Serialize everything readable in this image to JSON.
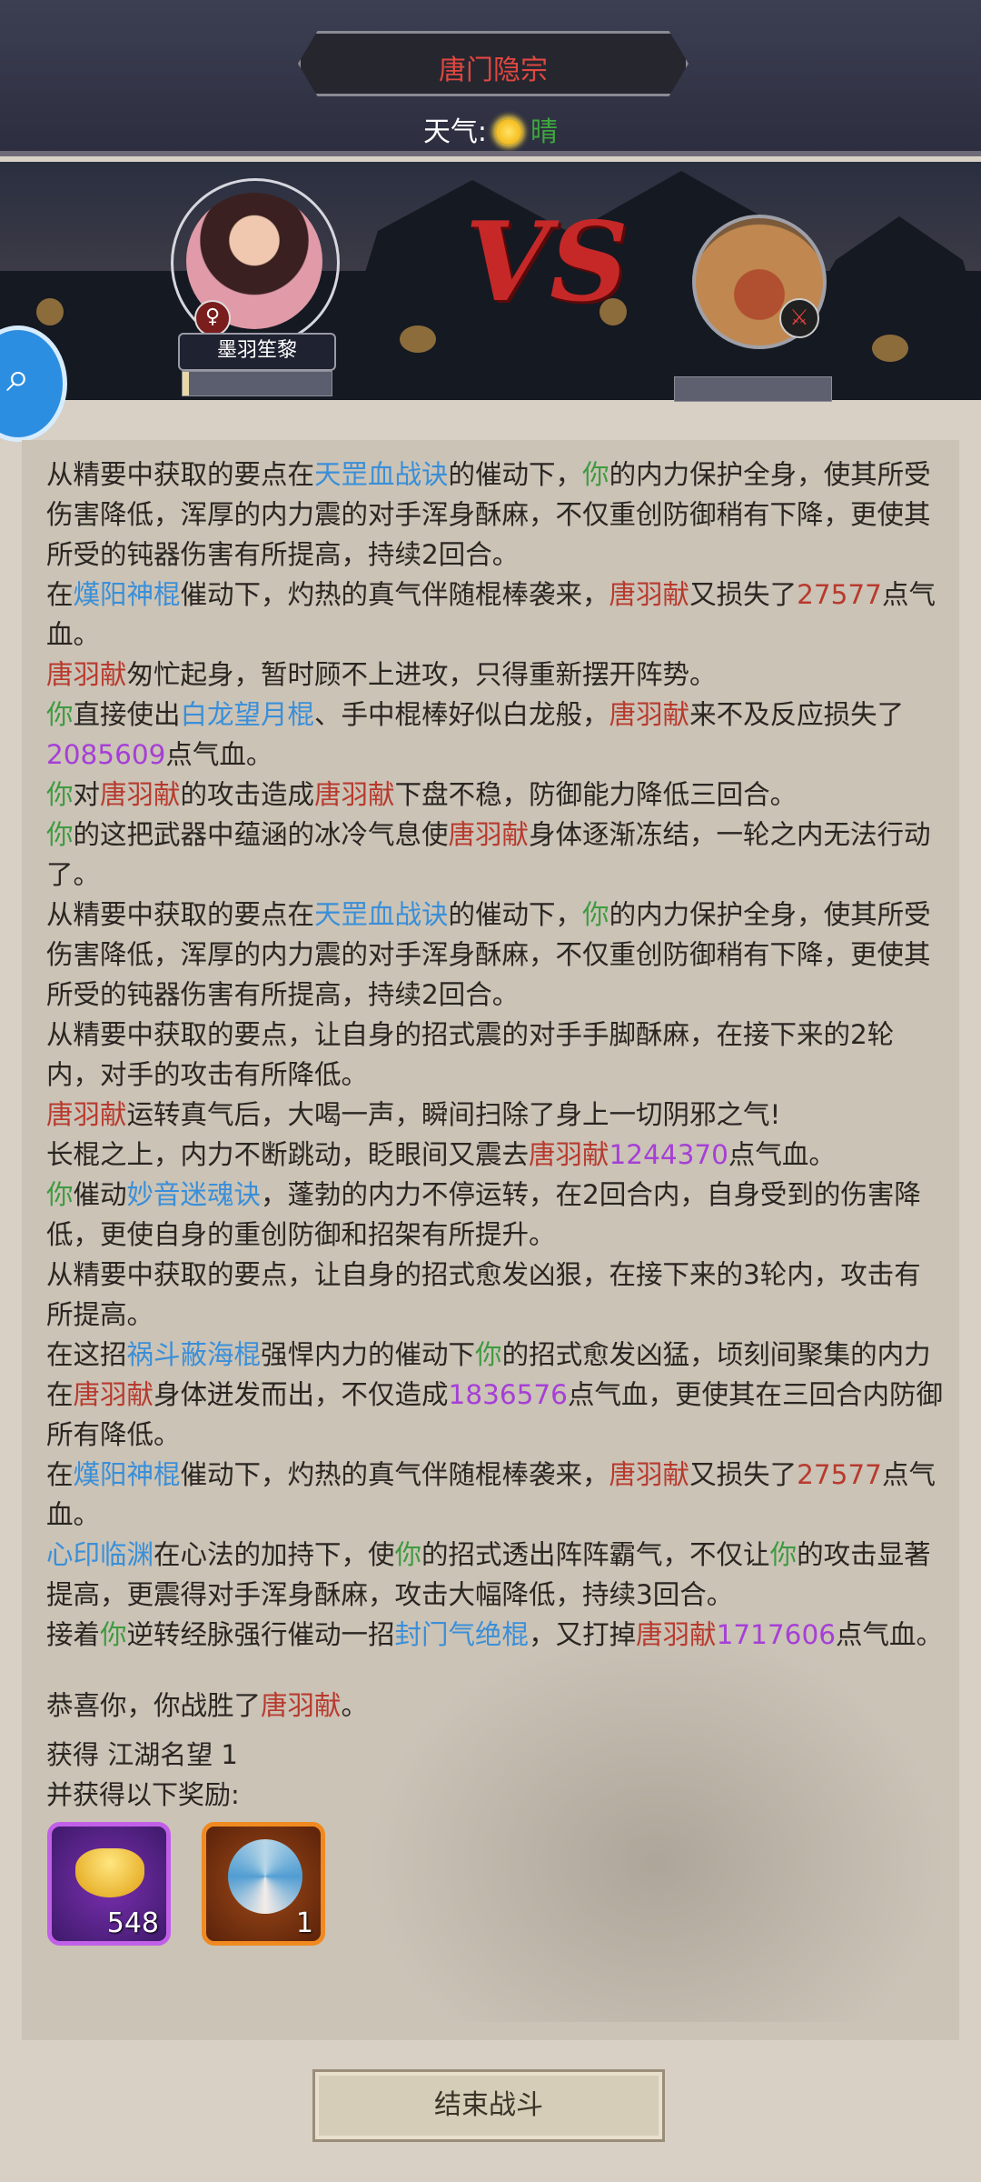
{
  "header": {
    "title": "唐门隐宗",
    "weather_label": "天气:",
    "weather_value": "晴",
    "weather_icon": "sun-icon"
  },
  "battle": {
    "player": {
      "name": "墨羽笙黎",
      "gender_symbol": "♀"
    },
    "enemy": {
      "badge_icon": "weapon-badge-icon"
    },
    "vs_label": "VS"
  },
  "search_icon": "magnifier-icon",
  "log": [
    [
      {
        "t": "从精要中获取的要点在"
      },
      {
        "t": "天罡血战诀",
        "c": "b"
      },
      {
        "t": "的催动下，"
      },
      {
        "t": "你",
        "c": "g"
      },
      {
        "t": "的内力保护全身，使其所受伤害降低，浑厚的内力震的对手浑身酥麻，不仅重创防御稍有下降，更使其所受的钝器伤害有所提高，持续2回合。"
      }
    ],
    [
      {
        "t": "在"
      },
      {
        "t": "熯阳神棍",
        "c": "b"
      },
      {
        "t": "催动下，灼热的真气伴随棍棒袭来，"
      },
      {
        "t": "唐羽献",
        "c": "r"
      },
      {
        "t": "又损失了"
      },
      {
        "t": "27577",
        "c": "r"
      },
      {
        "t": "点气血。"
      }
    ],
    [
      {
        "t": "唐羽献",
        "c": "r"
      },
      {
        "t": "匆忙起身，暂时顾不上进攻，只得重新摆开阵势。"
      }
    ],
    [
      {
        "t": "你",
        "c": "g"
      },
      {
        "t": "直接使出"
      },
      {
        "t": "白龙望月棍",
        "c": "b"
      },
      {
        "t": "、手中棍棒好似白龙般，"
      },
      {
        "t": "唐羽献",
        "c": "r"
      },
      {
        "t": "来不及反应损失了"
      },
      {
        "t": "2085609",
        "c": "p"
      },
      {
        "t": "点气血。"
      }
    ],
    [
      {
        "t": "你",
        "c": "g"
      },
      {
        "t": "对"
      },
      {
        "t": "唐羽献",
        "c": "r"
      },
      {
        "t": "的攻击造成"
      },
      {
        "t": "唐羽献",
        "c": "r"
      },
      {
        "t": "下盘不稳，防御能力降低三回合。"
      }
    ],
    [
      {
        "t": "你",
        "c": "g"
      },
      {
        "t": "的这把武器中蕴涵的冰冷气息使"
      },
      {
        "t": "唐羽献",
        "c": "r"
      },
      {
        "t": "身体逐渐冻结，一轮之内无法行动了。"
      }
    ],
    [
      {
        "t": "从精要中获取的要点在"
      },
      {
        "t": "天罡血战诀",
        "c": "b"
      },
      {
        "t": "的催动下，"
      },
      {
        "t": "你",
        "c": "g"
      },
      {
        "t": "的内力保护全身，使其所受伤害降低，浑厚的内力震的对手浑身酥麻，不仅重创防御稍有下降，更使其所受的钝器伤害有所提高，持续2回合。"
      }
    ],
    [
      {
        "t": "从精要中获取的要点，让自身的招式震的对手手脚酥麻，在接下来的2轮内，对手的攻击有所降低。"
      }
    ],
    [
      {
        "t": "唐羽献",
        "c": "r"
      },
      {
        "t": "运转真气后，大喝一声，瞬间扫除了身上一切阴邪之气!"
      }
    ],
    [
      {
        "t": "长棍之上，内力不断跳动，眨眼间又震去"
      },
      {
        "t": "唐羽献",
        "c": "r"
      },
      {
        "t": "1244370",
        "c": "p"
      },
      {
        "t": "点气血。"
      }
    ],
    [
      {
        "t": "你",
        "c": "g"
      },
      {
        "t": "催动"
      },
      {
        "t": "妙音迷魂诀",
        "c": "b"
      },
      {
        "t": "，蓬勃的内力不停运转，在2回合内，自身受到的伤害降低，更使自身的重创防御和招架有所提升。"
      }
    ],
    [
      {
        "t": "从精要中获取的要点，让自身的招式愈发凶狠，在接下来的3轮内，攻击有所提高。"
      }
    ],
    [
      {
        "t": "在这招"
      },
      {
        "t": "祸斗蔽海棍",
        "c": "b"
      },
      {
        "t": "强悍内力的催动下"
      },
      {
        "t": "你",
        "c": "g"
      },
      {
        "t": "的招式愈发凶猛，顷刻间聚集的内力在"
      },
      {
        "t": "唐羽献",
        "c": "r"
      },
      {
        "t": "身体迸发而出，不仅造成"
      },
      {
        "t": "1836576",
        "c": "p"
      },
      {
        "t": "点气血，更使其在三回合内防御所有降低。"
      }
    ],
    [
      {
        "t": "在"
      },
      {
        "t": "熯阳神棍",
        "c": "b"
      },
      {
        "t": "催动下，灼热的真气伴随棍棒袭来，"
      },
      {
        "t": "唐羽献",
        "c": "r"
      },
      {
        "t": "又损失了"
      },
      {
        "t": "27577",
        "c": "r"
      },
      {
        "t": "点气血。"
      }
    ],
    [
      {
        "t": "心印临渊",
        "c": "b"
      },
      {
        "t": "在心法的加持下，使"
      },
      {
        "t": "你",
        "c": "g"
      },
      {
        "t": "的招式透出阵阵霸气，不仅让"
      },
      {
        "t": "你",
        "c": "g"
      },
      {
        "t": "的攻击显著提高，更震得对手浑身酥麻，攻击大幅降低，持续3回合。"
      }
    ],
    [
      {
        "t": "接着"
      },
      {
        "t": "你",
        "c": "g"
      },
      {
        "t": "逆转经脉强行催动一招"
      },
      {
        "t": "封门气绝棍",
        "c": "b"
      },
      {
        "t": "，又打掉"
      },
      {
        "t": "唐羽献",
        "c": "r"
      },
      {
        "t": "1717606",
        "c": "p"
      },
      {
        "t": "点气血。"
      }
    ]
  ],
  "result": {
    "win_prefix": "恭喜你，你战胜了",
    "win_enemy": "唐羽献",
    "win_suffix": "。",
    "fame": "获得 江湖名望 1",
    "reward_title": "并获得以下奖励:",
    "rewards": [
      {
        "icon": "gold-ingot-icon",
        "qty": "548"
      },
      {
        "icon": "swirl-token-icon",
        "qty": "1"
      }
    ]
  },
  "end_button": "结束战斗",
  "colors": {
    "skill": "#3a8fd8",
    "self": "#3e9b40",
    "enemy": "#b83a2e",
    "damage": "#a63fd6"
  }
}
